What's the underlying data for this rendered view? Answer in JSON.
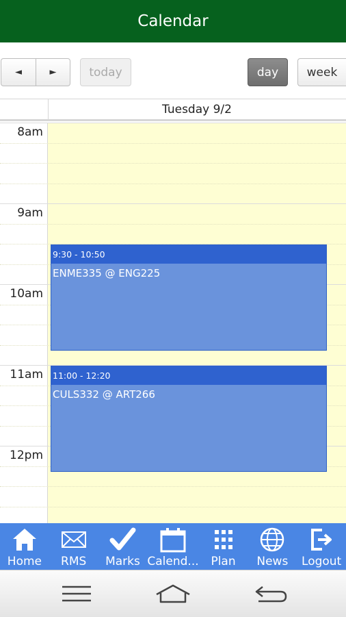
{
  "header": {
    "title": "Calendar"
  },
  "toolbar": {
    "prev_label": "◄",
    "next_label": "►",
    "today_label": "today",
    "day_label": "day",
    "week_label": "week",
    "active_view": "day"
  },
  "calendar": {
    "day_header": "Tuesday 9/2",
    "hours": [
      "8am",
      "9am",
      "10am",
      "11am",
      "12pm"
    ],
    "events": [
      {
        "time": "9:30 - 10:50",
        "title": "ENME335 @ ENG225"
      },
      {
        "time": "11:00 - 12:20",
        "title": "CULS332 @ ART266"
      }
    ]
  },
  "bottom_nav": {
    "items": [
      {
        "label": "Home",
        "icon": "home-icon"
      },
      {
        "label": "RMS",
        "icon": "mail-icon"
      },
      {
        "label": "Marks",
        "icon": "checkmark-icon"
      },
      {
        "label": "Calend...",
        "icon": "calendar-icon"
      },
      {
        "label": "Plan",
        "icon": "grid-icon"
      },
      {
        "label": "News",
        "icon": "globe-icon"
      },
      {
        "label": "Logout",
        "icon": "logout-icon"
      }
    ]
  },
  "system_nav": {
    "icons": [
      "menu-icon",
      "home-outline-icon",
      "back-icon"
    ]
  },
  "colors": {
    "title_bar": "#06611e",
    "event_header": "#2f62cf",
    "event_body": "#6a93dc",
    "day_background": "#fefed3",
    "bottom_nav": "#4a86e4"
  }
}
